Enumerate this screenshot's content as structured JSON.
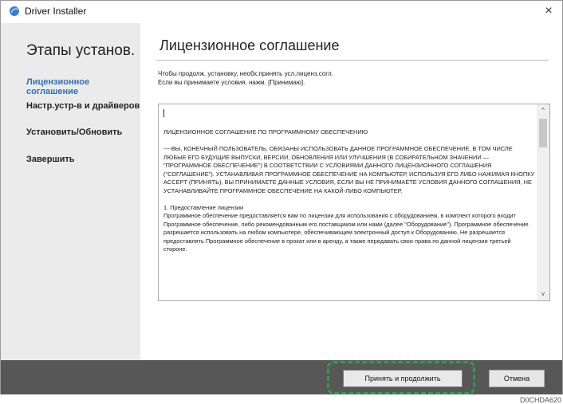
{
  "window": {
    "title": "Driver Installer",
    "close_symbol": "×"
  },
  "sidebar": {
    "heading": "Этапы установ.",
    "steps": [
      {
        "label": "Лицензионное соглашение",
        "active": true
      },
      {
        "label": "Настр.устр-в и драйверов",
        "active": false
      },
      {
        "label": "Установить/Обновить",
        "active": false
      },
      {
        "label": "Завершить",
        "active": false
      }
    ]
  },
  "main": {
    "title": "Лицензионное соглашение",
    "instruction_line1": "Чтобы продолж. установку, необх.принять усл.лиценз.согл.",
    "instruction_line2": "Если вы принимаете условия, нажм. [Принимаю].",
    "license": {
      "heading": "ЛИЦЕНЗИОННОЕ СОГЛАШЕНИЕ ПО ПРОГРАММНОМУ ОБЕСПЕЧЕНИЮ",
      "para1": "----ВЫ, КОНЕЧНЫЙ ПОЛЬЗОВАТЕЛЬ, ОБЯЗАНЫ ИСПОЛЬЗОВАТЬ ДАННОЕ ПРОГРАММНОЕ ОБЕСПЕЧЕНИЕ, В ТОМ ЧИСЛЕ ЛЮБЫЕ ЕГО БУДУЩИЕ ВЫПУСКИ, ВЕРСИИ, ОБНОВЛЕНИЯ ИЛИ УЛУЧШЕНИЯ (В СОБИРАТЕЛЬНОМ ЗНАЧЕНИИ — \"ПРОГРАММНОЕ ОБЕСПЕЧЕНИЕ\") В СООТВЕТСТВИИ С УСЛОВИЯМИ ДАННОГО ЛИЦЕНЗИОННОГО СОГЛАШЕНИЯ (\"СОГЛАШЕНИЕ\"). УСТАНАВЛИВАЯ ПРОГРАММНОЕ ОБЕСПЕЧЕНИЕ НА КОМПЬЮТЕР, ИСПОЛЬЗУЯ ЕГО ЛИБО НАЖИМАЯ КНОПКУ ACCEPT (ПРИНЯТЬ), ВЫ ПРИНИМАЕТЕ ДАННЫЕ УСЛОВИЯ, ЕСЛИ ВЫ НЕ ПРИНИМАЕТЕ УСЛОВИЯ ДАННОГО СОГЛАШЕНИЯ, НЕ УСТАНАВЛИВАЙТЕ ПРОГРАММНОЕ ОБЕСПЕЧЕНИЕ НА КАКОЙ-ЛИБО КОМПЬЮТЕР.",
      "section_title": "1. Предоставление лицензии",
      "section_body": "Программное обеспечение предоставляется вам по лицензии для использования с оборудованием, в комплект которого входит Программное обеспечение, либо рекомендованным его поставщиком или нами (далее \"Оборудование\"). Программное обеспечение разрешается использовать на любом компьютере, обеспечивающем электронный доступ к Оборудованию. Не разрешается предоставлять Программное обеспечение в прокат или в аренду, а также передавать свои права по данной лицензии третьей стороне.",
      "scroll_up_symbol": "^",
      "scroll_down_symbol": "v"
    }
  },
  "footer": {
    "accept_label": "Принять и продолжить",
    "cancel_label": "Отмена"
  },
  "watermark": "D0CHDA620",
  "colors": {
    "active_step": "#2a6fb6",
    "footer_bg": "#575757",
    "highlight": "#2aa04a"
  }
}
